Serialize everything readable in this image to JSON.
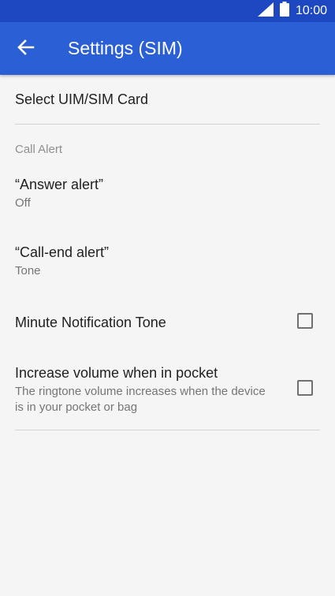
{
  "status_bar": {
    "time": "10:00",
    "icons": [
      "signal-icon",
      "battery-icon"
    ]
  },
  "app_bar": {
    "back_icon": "arrow-back-icon",
    "title": "Settings (SIM)"
  },
  "settings": {
    "select_card": {
      "title": "Select UIM/SIM Card"
    },
    "call_alert_category": "Call Alert",
    "answer_alert": {
      "title": "“Answer alert”",
      "summary": "Off"
    },
    "call_end_alert": {
      "title": "“Call-end alert”",
      "summary": "Tone"
    },
    "minute_tone": {
      "title": "Minute Notification Tone",
      "checked": false
    },
    "increase_volume": {
      "title": "Increase volume when in pocket",
      "summary": "The ringtone volume increases when the device is in your pocket or bag",
      "checked": false
    }
  },
  "colors": {
    "status_bar": "#1d48c2",
    "app_bar": "#2b5fd6",
    "background": "#f5f5f5",
    "primary_text": "#212121",
    "secondary_text": "#757575"
  }
}
